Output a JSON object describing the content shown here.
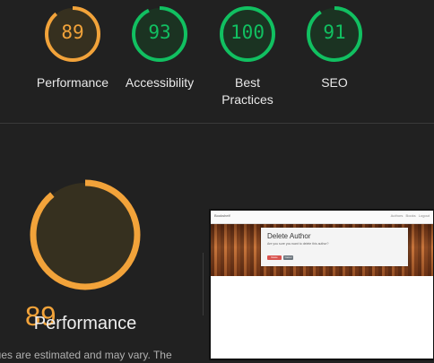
{
  "scores": [
    {
      "label": "Performance",
      "value": "89",
      "color": "#f2a33a"
    },
    {
      "label": "Accessibility",
      "value": "93",
      "color": "#11c061"
    },
    {
      "label": "Best\nPractices",
      "value": "100",
      "color": "#11c061"
    },
    {
      "label": "SEO",
      "value": "91",
      "color": "#11c061"
    }
  ],
  "main": {
    "score": "89",
    "label": "Performance",
    "note": "lues are estimated and may vary. The"
  },
  "screenshot": {
    "brand": "Bookshelf",
    "nav_links": "Authors Books Logout",
    "card_title": "Delete Author",
    "card_sub": "Are you sure you want to delete this author?",
    "delete_label": "Delete",
    "cancel_label": "Cancel"
  }
}
